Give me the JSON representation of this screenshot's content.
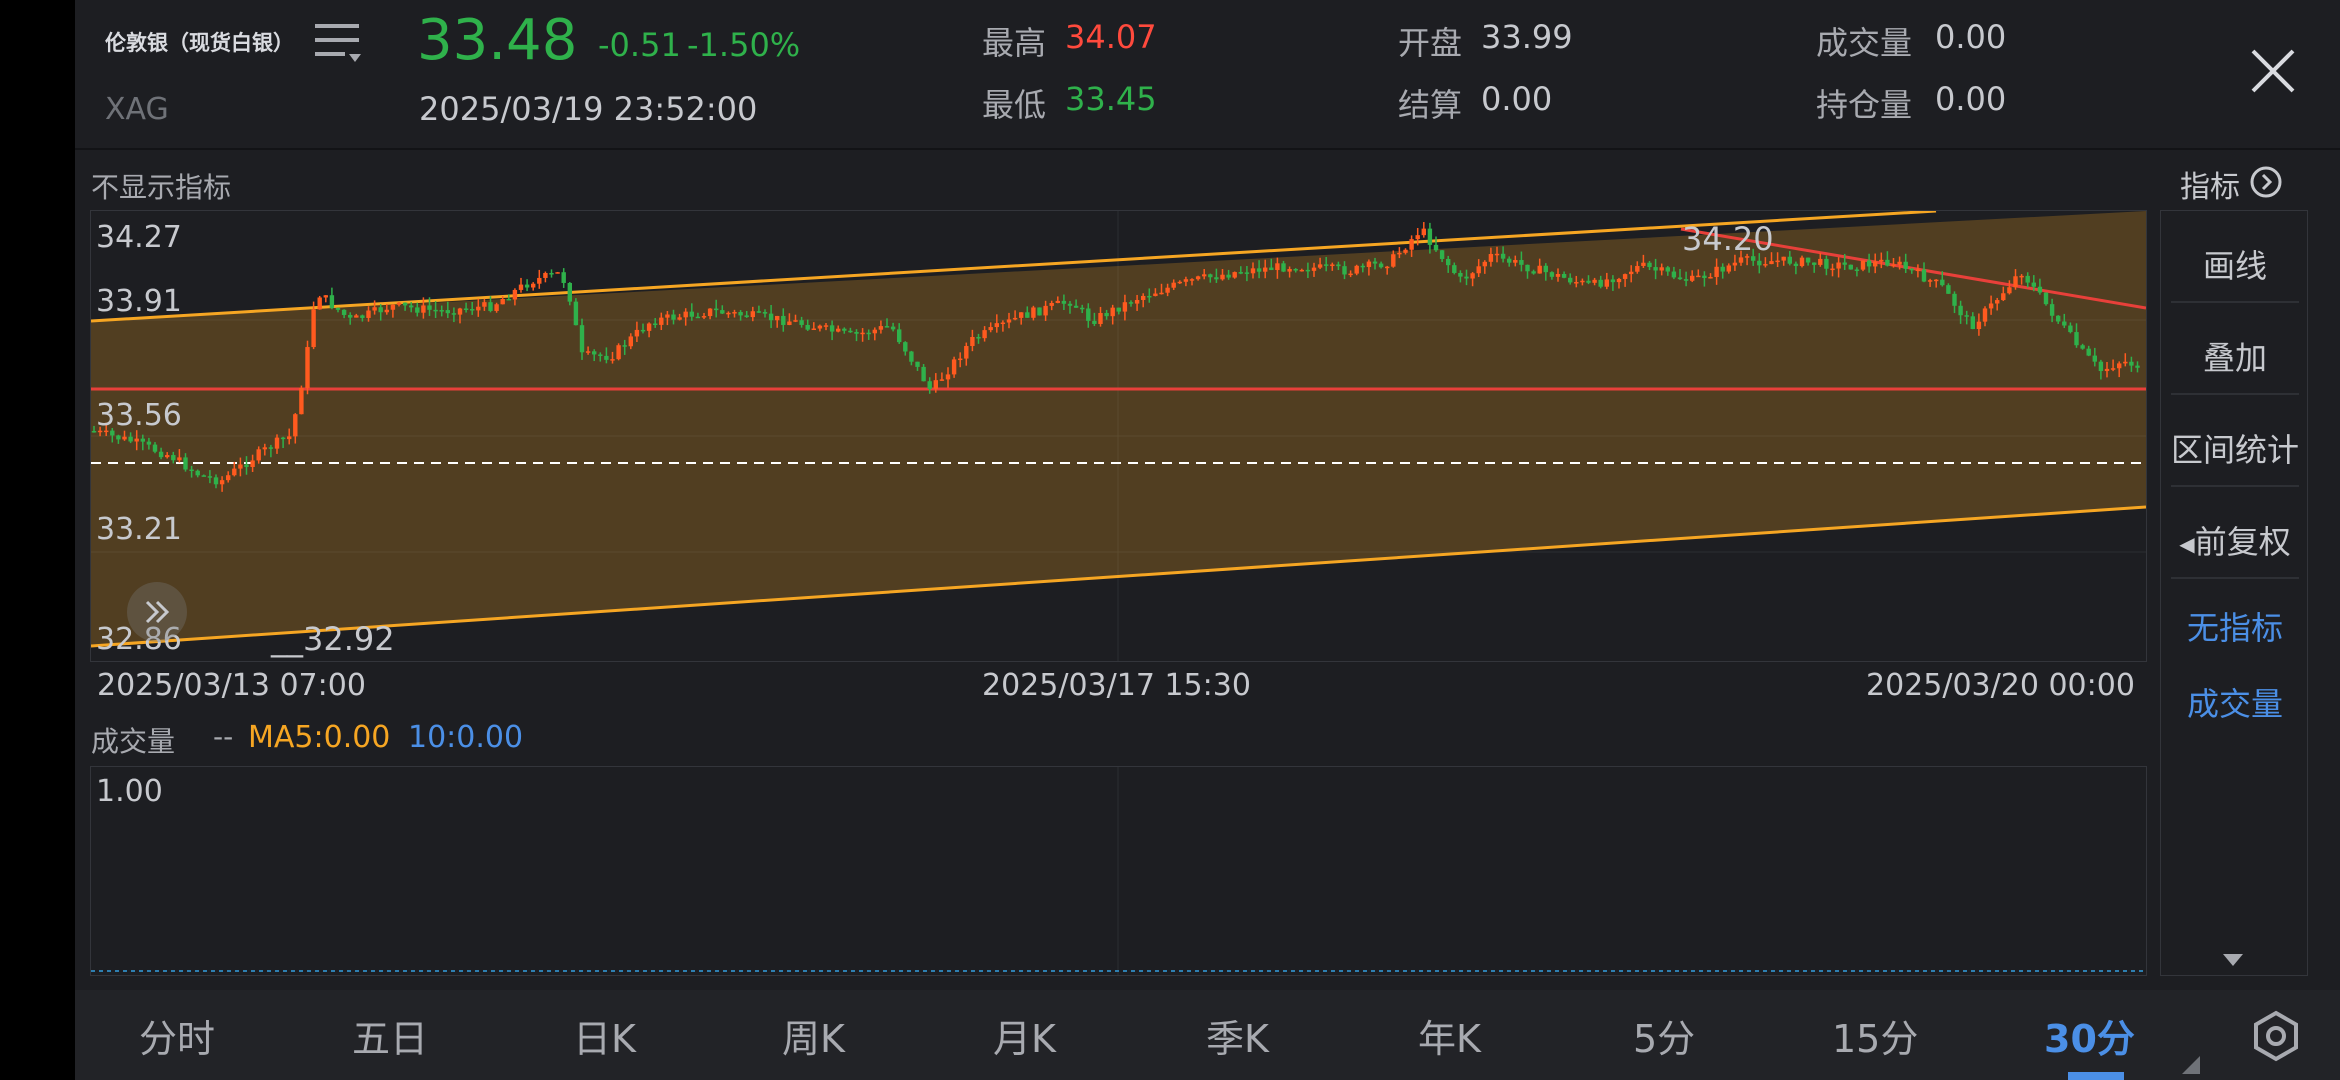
{
  "header": {
    "name": "伦敦银（现货白银）",
    "code": "XAG",
    "price": "33.48",
    "change": "-0.51",
    "change_pct": "-1.50%",
    "datetime": "2025/03/19 23:52:00",
    "high_label": "最高",
    "high_value": "34.07",
    "low_label": "最低",
    "low_value": "33.45",
    "open_label": "开盘",
    "open_value": "33.99",
    "settle_label": "结算",
    "settle_value": "0.00",
    "volume_label": "成交量",
    "volume_value": "0.00",
    "position_label": "持仓量",
    "position_value": "0.00",
    "menu_icon": "menu-list-icon",
    "close_icon": "close-icon"
  },
  "chart": {
    "indicator_toggle": "不显示指标",
    "price_labels": [
      "34.27",
      "33.91",
      "33.56",
      "33.21",
      "32.86"
    ],
    "max_marker": "34.20",
    "min_marker": "32.92",
    "time_labels": [
      "2025/03/13 07:00",
      "2025/03/17 15:30",
      "2025/03/20 00:00"
    ],
    "expand_icon": "double-chevron-right-icon"
  },
  "volume": {
    "label": "成交量",
    "dash": "--",
    "ma5": "MA5:0.00",
    "ma10": "10:0.00",
    "max_label": "1.00"
  },
  "side_panel": {
    "indicator_btn": "指标",
    "items": [
      "画线",
      "叠加",
      "区间统计",
      "前复权",
      "无指标",
      "成交量"
    ],
    "scroll_icon": "triangle-down-icon"
  },
  "tabs": {
    "items": [
      "分时",
      "五日",
      "日K",
      "周K",
      "月K",
      "季K",
      "年K",
      "5分",
      "15分",
      "30分"
    ],
    "active_index": 9,
    "settings_icon": "hexagon-settings-icon"
  },
  "colors": {
    "up": "#ff5a1f",
    "down": "#2fb14b",
    "channel": "#f6a623",
    "trend": "#e8403a",
    "accent": "#4b8fe6"
  }
}
